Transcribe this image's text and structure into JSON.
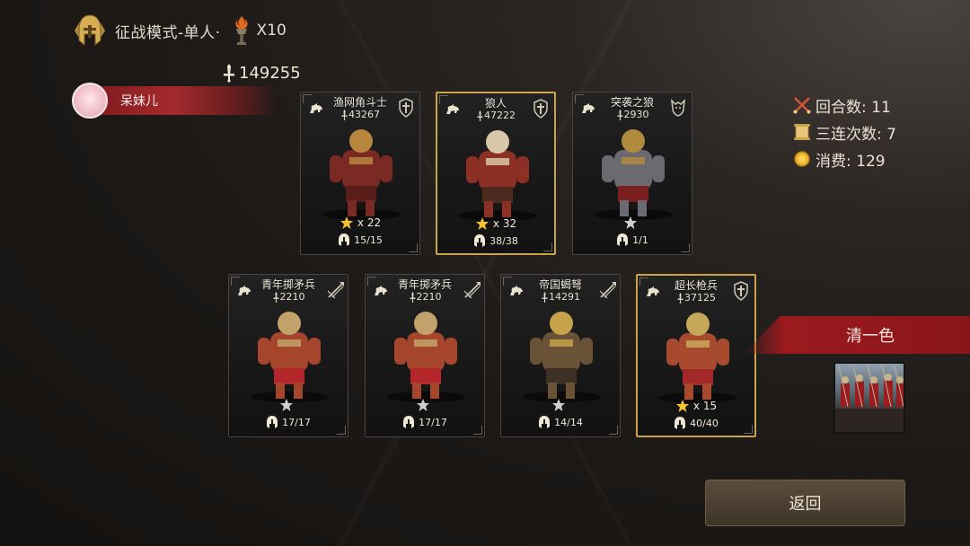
{
  "header": {
    "mode_title": "征战模式-单人·",
    "x_count": "X10"
  },
  "total_power": "149255",
  "player": {
    "name": "呆妹儿"
  },
  "stats": [
    {
      "icon": "crossed-swords-icon",
      "text": "回合数: 11"
    },
    {
      "icon": "scroll-icon",
      "text": "三连次数: 7"
    },
    {
      "icon": "coin-icon",
      "text": "消费: 129"
    }
  ],
  "cards": [
    {
      "name": "渔网角斗士",
      "power": "43267",
      "stars": "x 22",
      "troops": "15/15",
      "type": "cavalry",
      "rank": "shield",
      "gold": false
    },
    {
      "name": "狼人",
      "power": "47222",
      "stars": "x 32",
      "troops": "38/38",
      "type": "cavalry",
      "rank": "shield",
      "gold": true
    },
    {
      "name": "突袭之狼",
      "power": "2930",
      "stars": "",
      "troops": "1/1",
      "type": "cavalry",
      "rank": "wolf",
      "gold": false
    },
    {
      "name": "青年掷矛兵",
      "power": "2210",
      "stars": "",
      "troops": "17/17",
      "type": "cavalry",
      "rank": "spear",
      "gold": false
    },
    {
      "name": "青年掷矛兵",
      "power": "2210",
      "stars": "",
      "troops": "17/17",
      "type": "cavalry",
      "rank": "spear",
      "gold": false
    },
    {
      "name": "帝国蝎弩",
      "power": "14291",
      "stars": "",
      "troops": "14/14",
      "type": "cavalry",
      "rank": "spear",
      "gold": false
    },
    {
      "name": "超长枪兵",
      "power": "37125",
      "stars": "x 15",
      "troops": "40/40",
      "type": "cavalry",
      "rank": "shield",
      "gold": true
    }
  ],
  "pure_color_label": "清一色",
  "back_label": "返回",
  "colors": {
    "accent_red": "#9b1a1e",
    "gold_border": "#c9a449",
    "star_gold": "#f2c230",
    "star_grey": "#cfcfcf"
  }
}
